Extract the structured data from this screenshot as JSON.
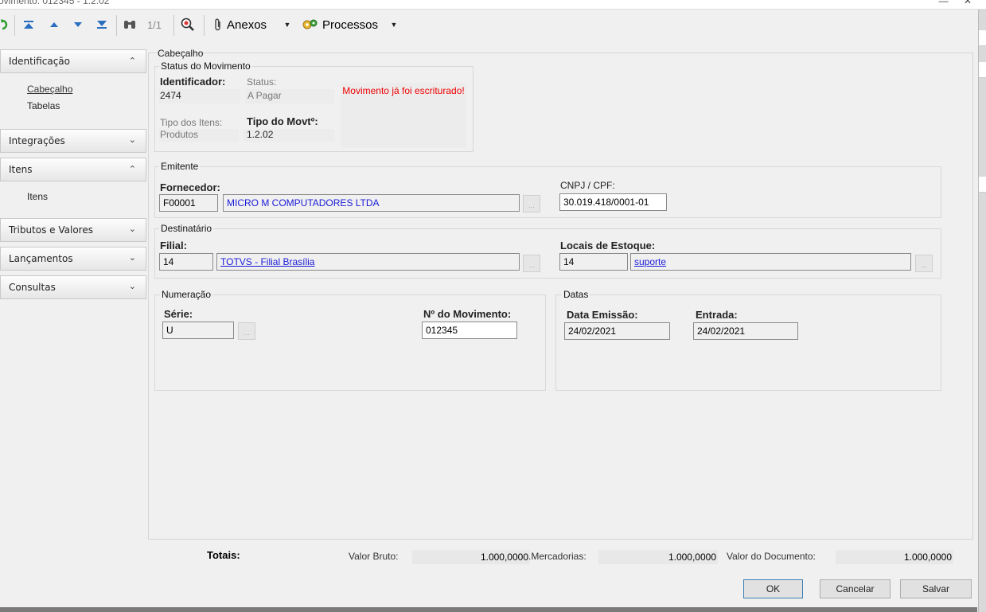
{
  "window": {
    "title": "ovimento: 012345 - 1.2.02",
    "controls": "— ✕"
  },
  "toolbar": {
    "record_counter": "1/1",
    "attachments_label": "Anexos",
    "processes_label": "Processos",
    "icons": [
      "refresh-icon",
      "first-record-icon",
      "previous-record-icon",
      "next-record-icon",
      "last-record-icon",
      "binoculars-icon",
      "zoom-icon",
      "paperclip-icon",
      "dropdown-arrow-icon",
      "gears-icon",
      "dropdown-arrow-icon"
    ]
  },
  "sidebar": {
    "sections": [
      {
        "label": "Identificação",
        "expanded": true,
        "items": [
          "Cabeçalho",
          "Tabelas"
        ]
      },
      {
        "label": "Integrações",
        "expanded": false,
        "items": []
      },
      {
        "label": "Itens",
        "expanded": true,
        "items": [
          "Itens"
        ]
      },
      {
        "label": "Tributos e Valores",
        "expanded": false,
        "items": []
      },
      {
        "label": "Lançamentos",
        "expanded": false,
        "items": []
      },
      {
        "label": "Consultas",
        "expanded": false,
        "items": []
      }
    ]
  },
  "form": {
    "panel_title": "Cabeçalho",
    "status_group": {
      "title": "Status do Movimento",
      "identificador_label": "Identificador:",
      "identificador_value": "2474",
      "status_label": "Status:",
      "status_value": "A Pagar",
      "message": "Movimento já foi escriturado!",
      "tipo_itens_label": "Tipo dos Itens:",
      "tipo_itens_value": "Produtos",
      "tipo_movto_label": "Tipo do Movtº:",
      "tipo_movto_value": "1.2.02"
    },
    "emitente": {
      "title": "Emitente",
      "fornecedor_label": "Fornecedor:",
      "fornecedor_code": "F00001",
      "fornecedor_name": "MICRO M COMPUTADORES LTDA",
      "cnpj_label": "CNPJ / CPF:",
      "cnpj_value": "30.019.418/0001-01"
    },
    "destinatario": {
      "title": "Destinatário",
      "filial_label": "Filial:",
      "filial_code": "14",
      "filial_name": "TOTVS - Filial Brasília",
      "locais_label": "Locais de Estoque:",
      "locais_code": "14",
      "locais_name": "suporte"
    },
    "numeracao": {
      "title": "Numeração",
      "serie_label": "Série:",
      "serie_value": "U",
      "numero_label": "Nº do Movimento:",
      "numero_value": "012345"
    },
    "datas": {
      "title": "Datas",
      "emissao_label": "Data Emissão:",
      "emissao_value": "24/02/2021",
      "entrada_label": "Entrada:",
      "entrada_value": "24/02/2021"
    },
    "ellipsis": "..."
  },
  "totals": {
    "label": "Totais:",
    "valor_bruto_label": "Valor Bruto:",
    "valor_bruto_value": "1.000,0000",
    "mercadorias_label": ".Mercadorias:",
    "mercadorias_value": "1.000,0000",
    "valor_documento_label": "Valor do Documento:",
    "valor_documento_value": "1.000,0000"
  },
  "buttons": {
    "ok": "OK",
    "cancel": "Cancelar",
    "save": "Salvar"
  },
  "colors": {
    "link": "#1a1ad8",
    "warning": "#e00000",
    "toolbar_icon": "#2a6ebf"
  }
}
